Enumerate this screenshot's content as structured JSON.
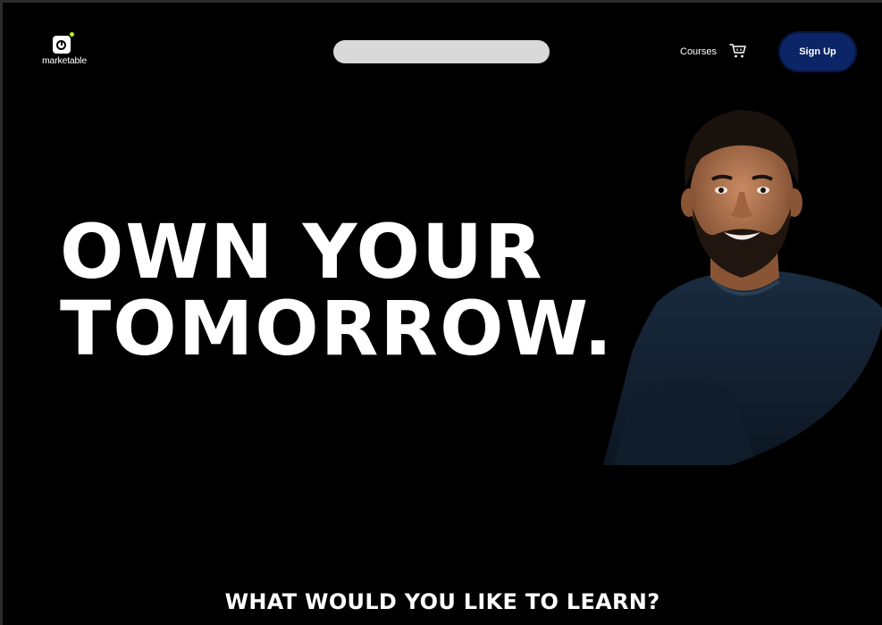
{
  "brand": {
    "name": "marketable",
    "accent_color": "#b9f028"
  },
  "header": {
    "search": {
      "placeholder": "",
      "value": ""
    },
    "nav_courses": "Courses",
    "cart_icon": "cart-icon",
    "signup_label": "Sign Up",
    "signup_color": "#0b2567"
  },
  "hero": {
    "title_line1": "OWN YOUR",
    "title_line2": "TOMORROW.",
    "image": "portrait-of-instructor"
  },
  "section": {
    "heading": "WHAT WOULD YOU LIKE TO LEARN?"
  }
}
